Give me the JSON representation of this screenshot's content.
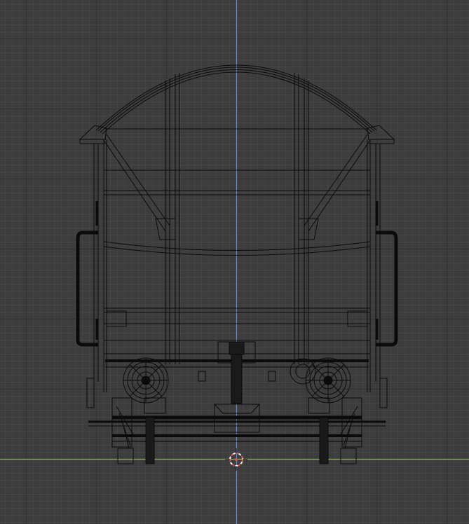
{
  "viewport": {
    "view": "front-orthographic",
    "shading": "wireframe",
    "object": "railway-wagon-model",
    "colors": {
      "background": "#3d3d3d",
      "wire": "#0b0b0b",
      "z_axis": "#5a8ee0",
      "x_axis": "#8cbf3a",
      "cursor": "#e05050"
    }
  }
}
